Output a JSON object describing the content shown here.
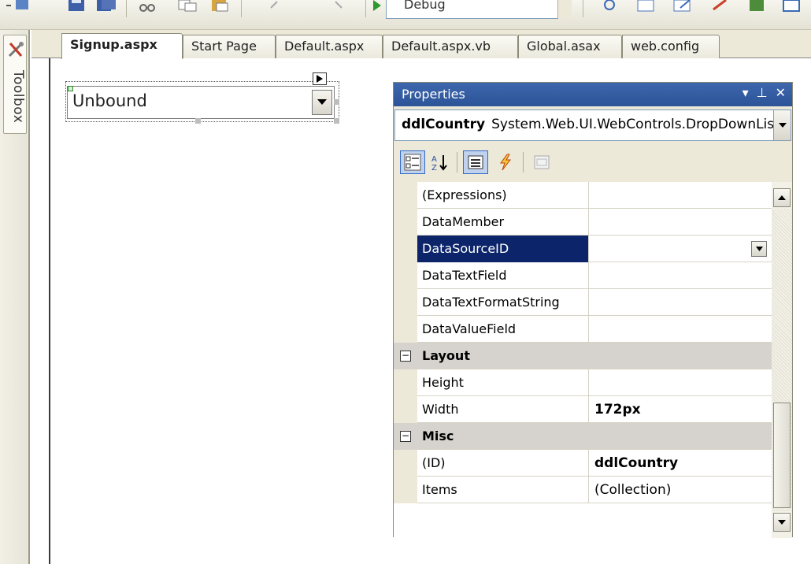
{
  "toolbar": {
    "configuration": "Debug"
  },
  "toolbox": {
    "label": "Toolbox"
  },
  "tabs": [
    {
      "label": "Signup.aspx",
      "active": true
    },
    {
      "label": "Start Page"
    },
    {
      "label": "Default.aspx"
    },
    {
      "label": "Default.aspx.vb"
    },
    {
      "label": "Global.asax"
    },
    {
      "label": "web.config"
    }
  ],
  "designer": {
    "dropdown_text": "Unbound"
  },
  "properties": {
    "title": "Properties",
    "object_name": "ddlCountry",
    "object_type": "System.Web.UI.WebControls.DropDownList",
    "rows": [
      {
        "name": "(Expressions)",
        "value": ""
      },
      {
        "name": "DataMember",
        "value": ""
      },
      {
        "name": "DataSourceID",
        "value": "",
        "selected": true
      },
      {
        "name": "DataTextField",
        "value": ""
      },
      {
        "name": "DataTextFormatString",
        "value": ""
      },
      {
        "name": "DataValueField",
        "value": ""
      },
      {
        "category": "Layout"
      },
      {
        "name": "Height",
        "value": ""
      },
      {
        "name": "Width",
        "value": "172px",
        "bold": true
      },
      {
        "category": "Misc"
      },
      {
        "name": "(ID)",
        "value": "ddlCountry",
        "bold": true
      },
      {
        "name": "Items",
        "value": "(Collection)"
      }
    ]
  },
  "colors": {
    "title_bar": "#2c5497",
    "selection": "#0b246a",
    "chrome": "#ece9d8"
  }
}
